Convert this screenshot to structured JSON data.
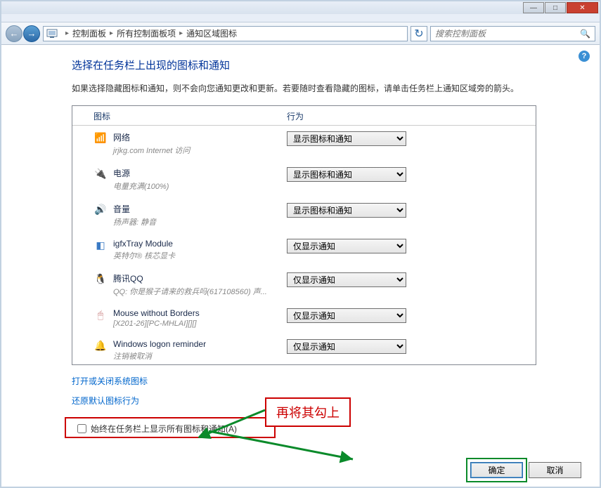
{
  "window": {
    "min": "—",
    "max": "□",
    "close": "✕"
  },
  "nav": {
    "back": "←",
    "forward": "→",
    "refresh": "↻",
    "search_placeholder": "搜索控制面板",
    "search_icon": "🔍"
  },
  "breadcrumb": {
    "root": "控制面板",
    "mid": "所有控制面板项",
    "leaf": "通知区域图标",
    "sep": "▸"
  },
  "help": "?",
  "page": {
    "title": "选择在任务栏上出现的图标和通知",
    "desc": "如果选择隐藏图标和通知，则不会向您通知更改和更新。若要随时查看隐藏的图标，请单击任务栏上通知区域旁的箭头。"
  },
  "headers": {
    "icon": "图标",
    "action": "行为"
  },
  "behaviors": {
    "show_all": "显示图标和通知",
    "notify_only": "仅显示通知"
  },
  "items": [
    {
      "icon": "📶",
      "icon_color": "#888",
      "title": "网络",
      "sub": "jrjkg.com Internet 访问",
      "sel": "show_all"
    },
    {
      "icon": "🔌",
      "icon_color": "#888",
      "title": "电源",
      "sub": "电量充满(100%)",
      "sel": "show_all"
    },
    {
      "icon": "🔊",
      "icon_color": "#c44",
      "title": "音量",
      "sub": "扬声器: 静音",
      "sel": "show_all"
    },
    {
      "icon": "◧",
      "icon_color": "#3a7ac4",
      "title": "igfxTray Module",
      "sub": "英特尔® 核芯显卡",
      "sel": "notify_only"
    },
    {
      "icon": "🐧",
      "icon_color": "#333",
      "title": "腾讯QQ",
      "sub": "QQ: 你是猴子请来的救兵吗(617108560)    声...",
      "sel": "notify_only"
    },
    {
      "icon": "🖱",
      "icon_color": "#c88",
      "title": "Mouse without Borders",
      "sub": "[X201-26][PC-MHLAI][][]",
      "sel": "notify_only"
    },
    {
      "icon": "🔔",
      "icon_color": "#b88",
      "title": "Windows logon reminder",
      "sub": "注销被取消",
      "sel": "notify_only"
    }
  ],
  "links": {
    "sys_icons": "打开或关闭系统图标",
    "restore": "还原默认图标行为"
  },
  "checkbox": {
    "label": "始终在任务栏上显示所有图标和通知(A)"
  },
  "buttons": {
    "ok": "确定",
    "cancel": "取消"
  },
  "annotation": {
    "text": "再将其勾上"
  }
}
